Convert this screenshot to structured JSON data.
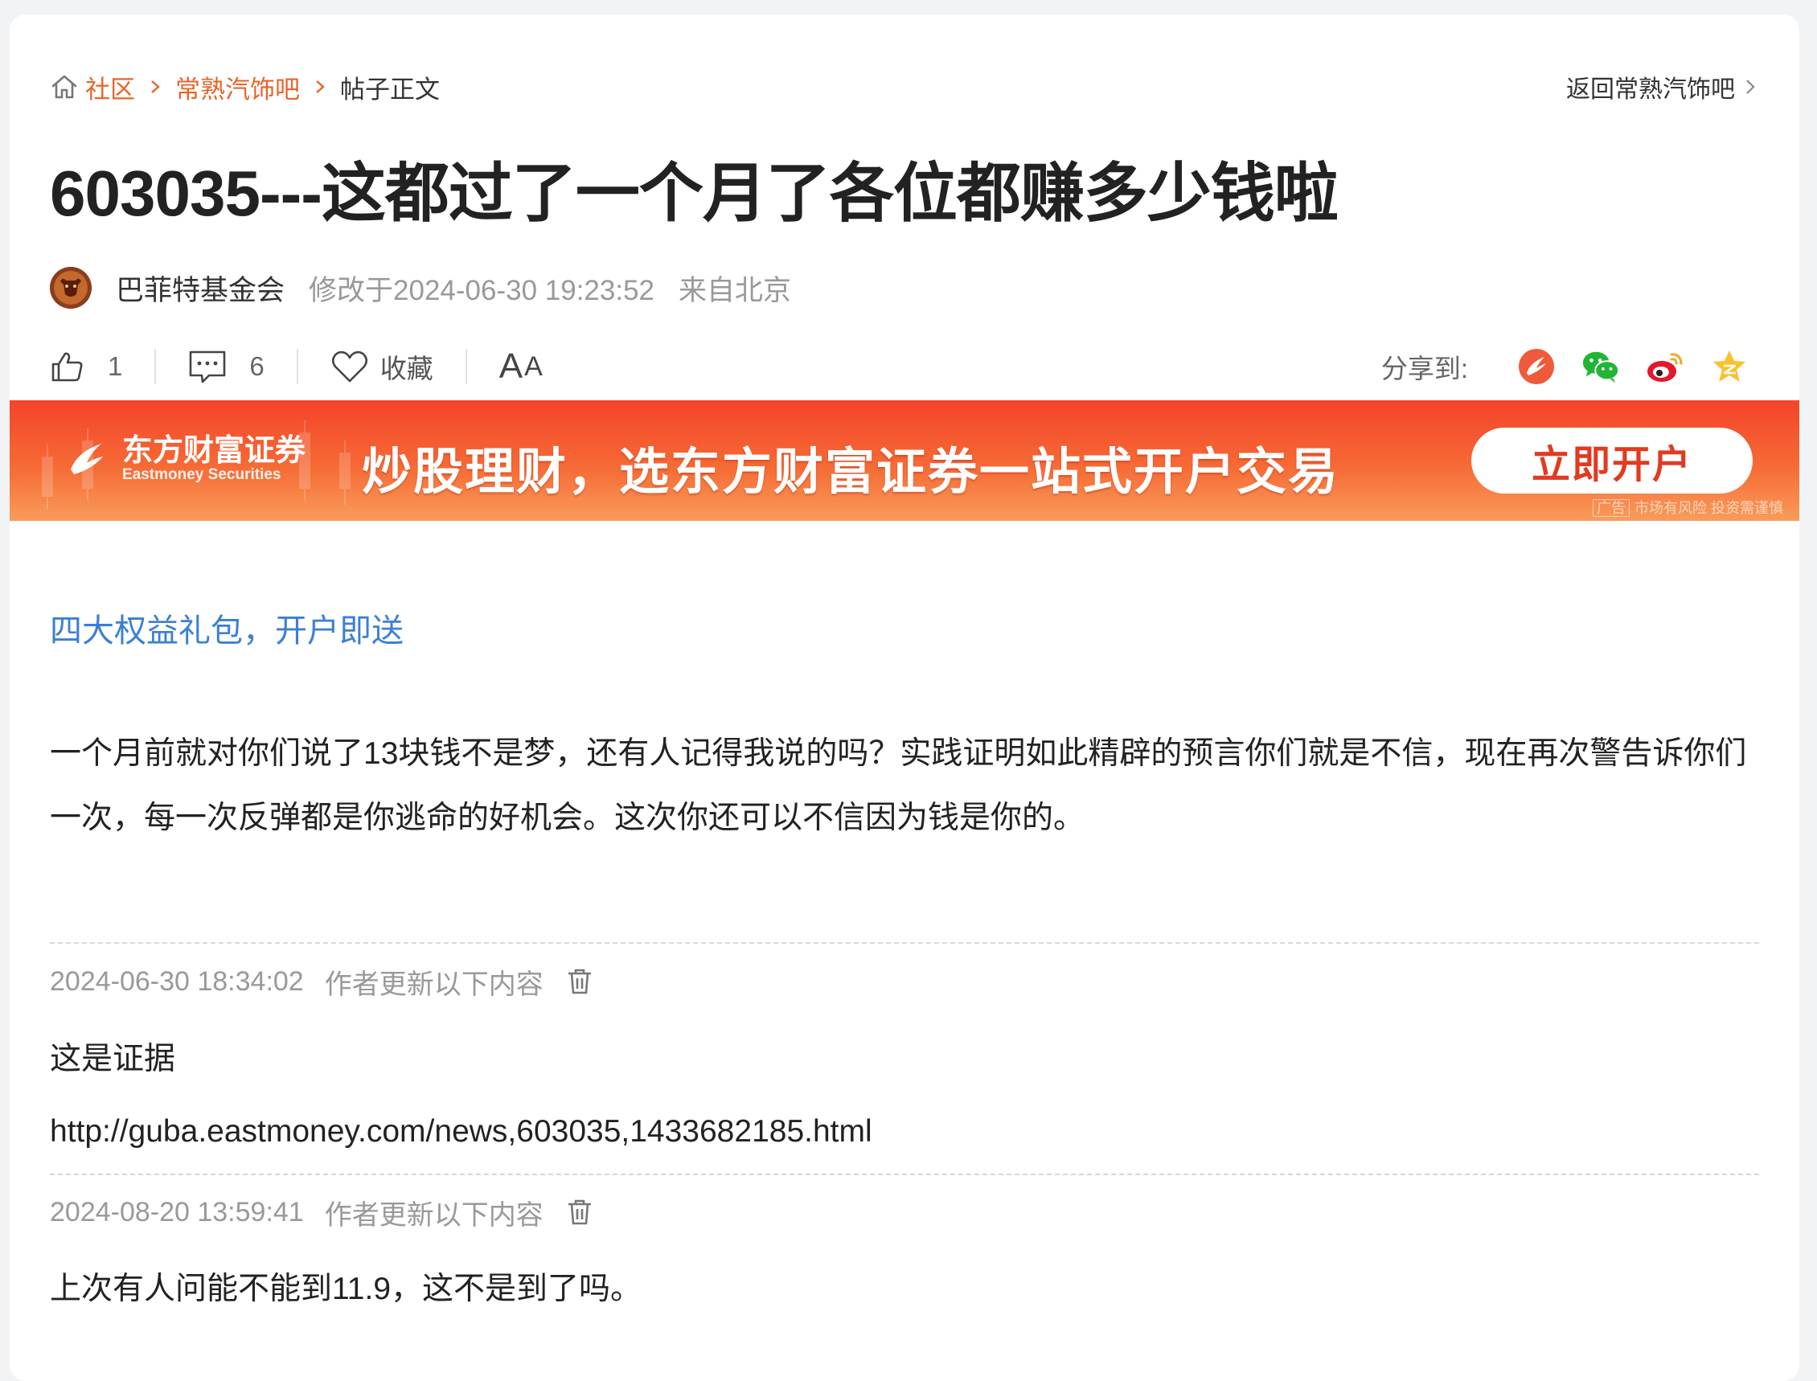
{
  "breadcrumb": {
    "home_icon": "home-icon",
    "items": [
      "社区",
      "常熟汽饰吧",
      "帖子正文"
    ]
  },
  "back_link": "返回常熟汽饰吧",
  "post": {
    "title": "603035---这都过了一个月了各位都赚多少钱啦",
    "author": "巴菲特基金会",
    "modified": "修改于2024-06-30 19:23:52",
    "location": "来自北京"
  },
  "actions": {
    "like_count": "1",
    "comment_count": "6",
    "favorite_label": "收藏",
    "font_big": "A",
    "font_small": "A"
  },
  "share": {
    "label": "分享到:",
    "targets": [
      "eastmoney-icon",
      "wechat-icon",
      "weibo-icon",
      "qzone-icon"
    ]
  },
  "banner": {
    "brand_cn": "东方财富证券",
    "brand_en": "Eastmoney Securities",
    "headline": "炒股理财，选东方财富证券一站式开户交易",
    "cta": "立即开户",
    "ad_tag": "广告",
    "risk_notice": "市场有风险 投资需谨慎"
  },
  "promo_link": "四大权益礼包，开户即送",
  "body": "一个月前就对你们说了13块钱不是梦，还有人记得我说的吗？实践证明如此精辟的预言你们就是不信，现在再次警告诉你们一次，每一次反弹都是你逃命的好机会。这次你还可以不信因为钱是你的。",
  "updates": [
    {
      "time": "2024-06-30 18:34:02",
      "label": "作者更新以下内容",
      "lines": [
        "这是证据",
        "http://guba.eastmoney.com/news,603035,1433682185.html"
      ]
    },
    {
      "time": "2024-08-20 13:59:41",
      "label": "作者更新以下内容",
      "lines": [
        "上次有人问能不能到11.9，这不是到了吗。"
      ]
    }
  ],
  "colors": {
    "accent_orange": "#e8642a",
    "link_blue": "#3b7fd3",
    "banner_red": "#f4442a",
    "muted_gray": "#999999"
  }
}
